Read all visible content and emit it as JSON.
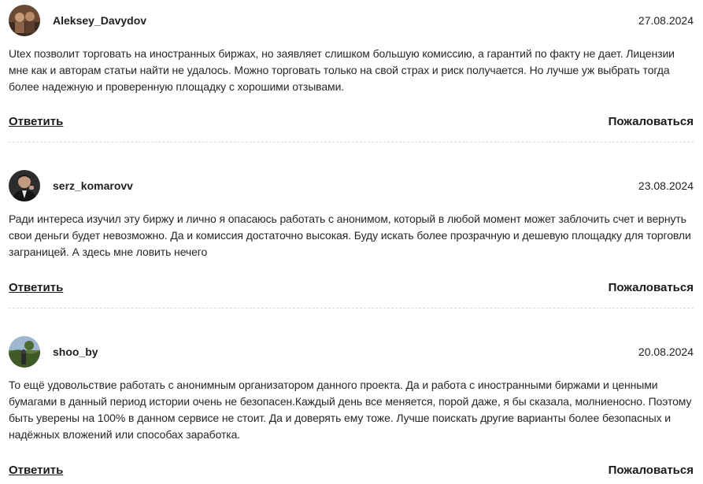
{
  "comments": [
    {
      "author": "Aleksey_Davydov",
      "date": "27.08.2024",
      "text": "Utex позволит торговать на иностранных биржах, но заявляет слишком большую комиссию, а гарантий по факту не дает. Лицензии мне как и авторам статьи найти не удалось. Можно торговать только на свой страх и риск получается. Но лучше уж выбрать тогда более надежную и проверенную площадку с хорошими отзывами.",
      "reply_label": "Ответить",
      "report_label": "Пожаловаться"
    },
    {
      "author": "serz_komarovv",
      "date": "23.08.2024",
      "text": "Ради интереса изучил эту биржу и лично я опасаюсь работать с анонимом, который в любой момент может заблочить счет и вернуть свои деньги будет невозможно. Да и комиссия достаточно высокая. Буду искать более прозрачную и дешевую площадку для торговли заграницей. А здесь мне ловить нечего",
      "reply_label": "Ответить",
      "report_label": "Пожаловаться"
    },
    {
      "author": "shoo_by",
      "date": "20.08.2024",
      "text": "То ещё удовольствие работать с анонимным организатором данного проекта. Да и работа с иностранными биржами и ценными бумагами в данный период истории очень не безопасен.Каждый день все меняется, порой даже, я бы сказала, молниеносно. Поэтому быть уверены на 100% в данном сервисе не стоит. Да и доверять ему тоже. Лучше поискать другие варианты более безопасных и надёжных вложений или способах заработка.",
      "reply_label": "Ответить",
      "report_label": "Пожаловаться"
    }
  ]
}
